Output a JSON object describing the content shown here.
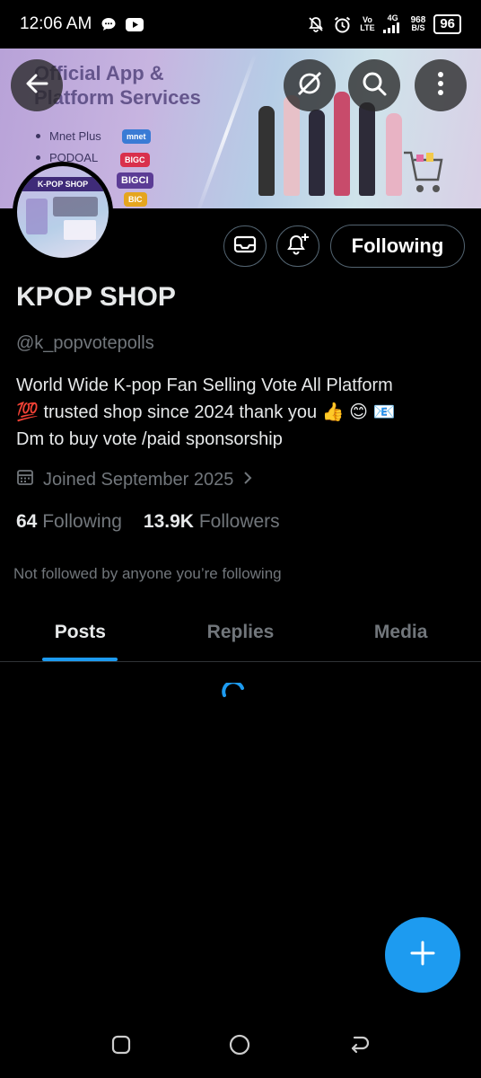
{
  "status_bar": {
    "time": "12:06 AM",
    "net_top": "Vo",
    "net_bottom": "LTE",
    "net_4g": "4G",
    "speed_value": "968",
    "speed_unit": "B/S",
    "battery": "96"
  },
  "banner": {
    "title_line1": "Official App &",
    "title_line2": "Platform Services",
    "list": [
      "Mnet Plus",
      "PODOAL"
    ],
    "chips": [
      "mnet",
      "BIGC",
      "BIGCI",
      "BIC"
    ]
  },
  "avatar": {
    "ribbon": "K-POP SHOP"
  },
  "profile": {
    "display_name": "KPOP SHOP",
    "handle": "@k_popvotepolls",
    "bio_line1": "World Wide K-pop Fan  Selling Vote All Platform",
    "bio_line2": "💯 trusted shop since 2024  thank you 👍 😊 📧",
    "bio_line3": "Dm to buy vote /paid sponsorship",
    "joined": "Joined September 2025",
    "following_count": "64",
    "following_label": "Following",
    "followers_count": "13.9K",
    "followers_label": "Followers",
    "not_followed_text": "Not followed by anyone you’re following"
  },
  "actions": {
    "following_button": "Following"
  },
  "tabs": [
    {
      "label": "Posts",
      "active": true
    },
    {
      "label": "Replies",
      "active": false
    },
    {
      "label": "Media",
      "active": false
    }
  ],
  "colors": {
    "accent": "#1d9bf0",
    "background": "#000000",
    "muted_text": "#71767b"
  },
  "icons": {
    "back": "back-arrow-icon",
    "grok": "grok-icon",
    "search": "search-icon",
    "more": "more-vertical-icon",
    "message": "mail-icon",
    "notify": "bell-plus-icon",
    "calendar": "calendar-icon",
    "compose": "plus-icon"
  }
}
